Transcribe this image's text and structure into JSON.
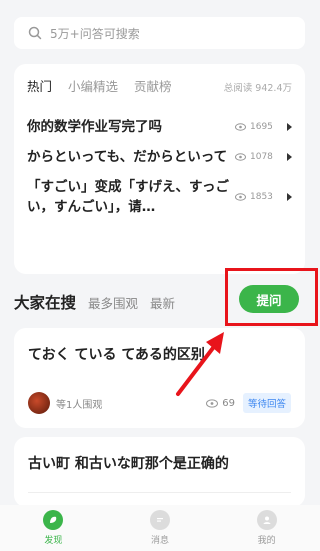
{
  "search": {
    "placeholder": "5万+问答可搜索"
  },
  "hot": {
    "tabs": [
      "热门",
      "小编精选",
      "贡献榜"
    ],
    "total_reads": "总阅读 942.4万",
    "items": [
      {
        "title": "你的数学作业写完了吗",
        "views": "1695"
      },
      {
        "title": "からといっても、だからといって",
        "views": "1078"
      },
      {
        "title": "「すごい」变成「すげえ、すっごい，すんごい」，请…",
        "views": "1853"
      }
    ]
  },
  "section": {
    "title": "大家在搜",
    "tabs": [
      "最多围观",
      "最新"
    ],
    "ask_label": "提问"
  },
  "questions": [
    {
      "title": "ておく ている てある的区别",
      "watchers": "等1人围观",
      "views": "69",
      "status": "等待回答"
    },
    {
      "title": "古い町 和古いな町那个是正确的"
    }
  ],
  "tabbar": {
    "items": [
      {
        "label": "发现"
      },
      {
        "label": "消息"
      },
      {
        "label": "我的"
      }
    ]
  },
  "colors": {
    "accent": "#3bb54a",
    "highlight": "#e8141b",
    "badge_text": "#3b86f0"
  }
}
